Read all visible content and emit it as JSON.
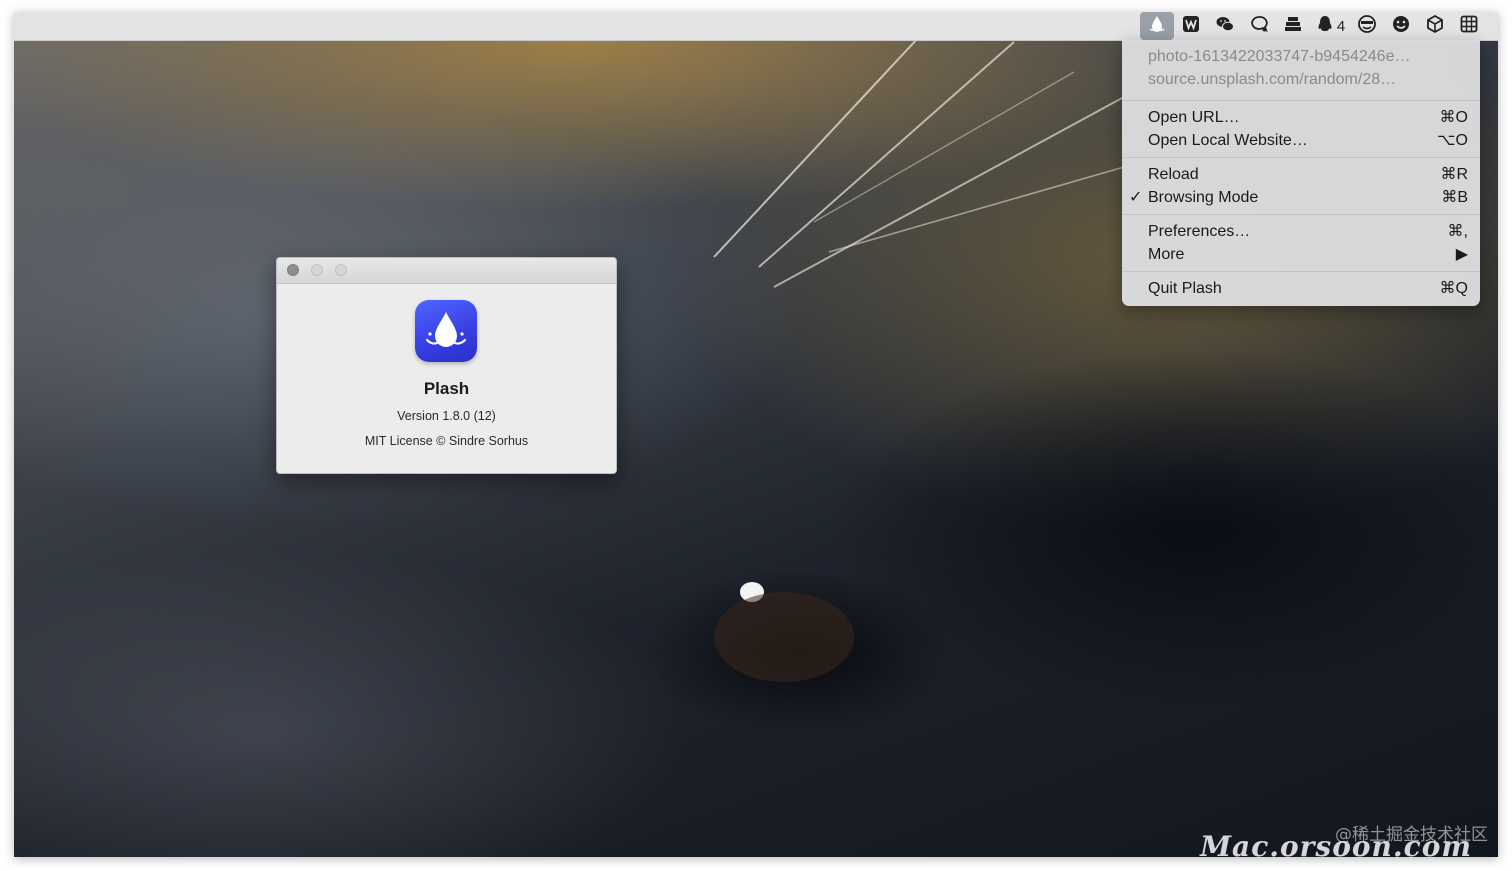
{
  "status_bar": {
    "items": [
      {
        "icon": "plash-drop-icon",
        "active": true
      },
      {
        "icon": "wordpress-icon"
      },
      {
        "icon": "wechat-icon"
      },
      {
        "icon": "chat-bubble-icon"
      },
      {
        "icon": "stack-icon"
      },
      {
        "icon": "qq-penguin-icon",
        "count": "4"
      },
      {
        "icon": "scan-face-icon"
      },
      {
        "icon": "emoji-face-icon"
      },
      {
        "icon": "cube-icon"
      },
      {
        "icon": "grid-icon"
      }
    ]
  },
  "menu": {
    "header_line1": "photo-1613422033747-b9454246e…",
    "header_line2": "source.unsplash.com/random/28…",
    "items": [
      {
        "label": "Open URL…",
        "shortcut": "⌘O"
      },
      {
        "label": "Open Local Website…",
        "shortcut": "⌥O"
      },
      {
        "label": "Reload",
        "shortcut": "⌘R"
      },
      {
        "label": "Browsing Mode",
        "shortcut": "⌘B",
        "checked": true
      },
      {
        "label": "Preferences…",
        "shortcut": "⌘,"
      },
      {
        "label": "More",
        "shortcut": "▶"
      },
      {
        "label": "Quit Plash",
        "shortcut": "⌘Q"
      }
    ],
    "check_mark": "✓"
  },
  "about": {
    "app_name": "Plash",
    "version": "Version 1.8.0 (12)",
    "license": "MIT License © Sindre Sorhus",
    "icon_colors": [
      "#4f67ff",
      "#2a2fc4"
    ]
  },
  "watermark": {
    "community": "@稀土掘金技术社区",
    "brand": "Mac.orsoon.com"
  }
}
